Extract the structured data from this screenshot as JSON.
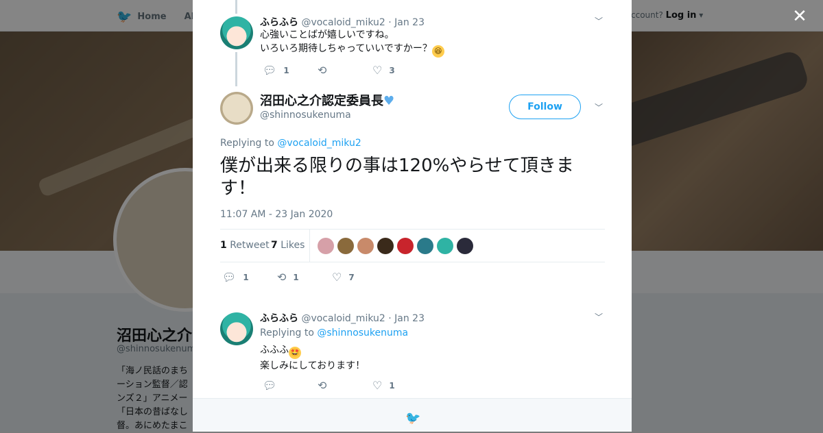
{
  "background": {
    "nav_home": "Home",
    "nav_about": "Abo",
    "account_prompt": "ccount?",
    "login": "Log in",
    "profile_name": "沼田心之介",
    "profile_handle": "@shinnosukenum",
    "bio_lines": [
      "「海ノ民話のまち",
      "ーション監督／認",
      "ンズ２」アニメー",
      "「日本の昔ばなし",
      "督。あにめたまこ"
    ]
  },
  "modal": {
    "tweet1": {
      "name": "ふらふら",
      "handle": "@vocaloid_miku2",
      "date": "· Jan 23",
      "line1": "心強いことばが嬉しいですね。",
      "line2": "いろいろ期待しちゃっていいですかー？",
      "emoji": "grinning-squinting-face",
      "reply_count": "1",
      "retweet_count": "",
      "like_count": "3"
    },
    "main_tweet": {
      "name": "沼田心之介認定委員長",
      "handle": "@shinnosukenuma",
      "follow_label": "Follow",
      "replying_prefix": "Replying to",
      "replying_to": "@vocaloid_miku2",
      "text": "僕が出来る限りの事は120%やらせて頂きます！",
      "timestamp": "11:07 AM - 23 Jan 2020",
      "retweets_num": "1",
      "retweets_label": "Retweet",
      "likes_num": "7",
      "likes_label": "Likes",
      "reply_count": "1",
      "retweet_count": "1",
      "like_count": "7"
    },
    "tweet3": {
      "name": "ふらふら",
      "handle": "@vocaloid_miku2",
      "date": "· Jan 23",
      "replying_prefix": "Replying to",
      "replying_to": "@shinnosukenuma",
      "line1": "ふふふ",
      "line2": "楽しみにしております！",
      "emoji": "star-struck-face",
      "reply_count": "",
      "retweet_count": "",
      "like_count": "1"
    }
  },
  "colors": {
    "accent": "#1da1f2",
    "text_primary": "#14171a",
    "text_secondary": "#657786",
    "like_faces": [
      "#d6a0a8",
      "#8a6a3c",
      "#c88a6a",
      "#3a2a1a",
      "#c8242c",
      "#2a7a8a",
      "#2fb3a4",
      "#2a2a3a"
    ]
  }
}
